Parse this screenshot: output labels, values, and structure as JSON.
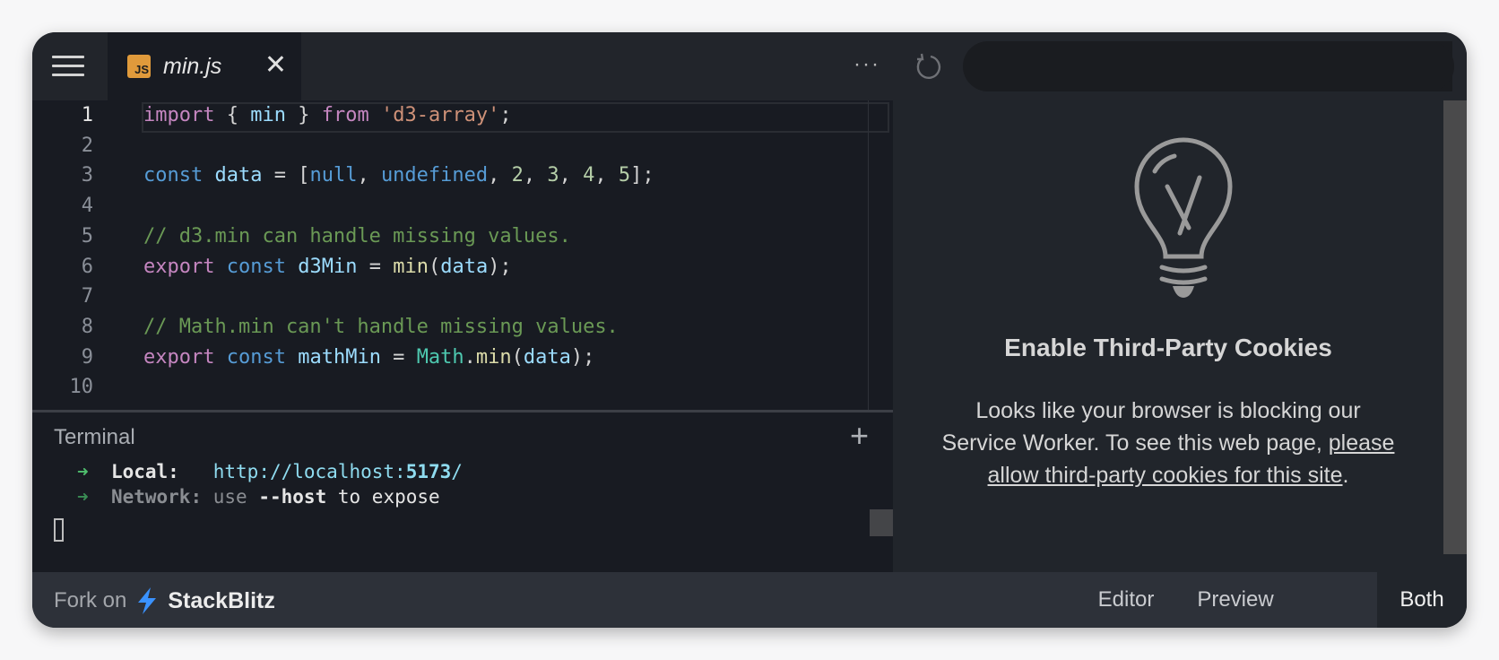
{
  "header": {
    "menu_icon": "hamburger-menu-icon",
    "tab": {
      "badge": "JS",
      "title": "min.js",
      "close_icon": "close-icon"
    },
    "more_label": "···",
    "refresh_icon": "refresh-icon",
    "url_value": ""
  },
  "editor": {
    "line_numbers": [
      "1",
      "2",
      "3",
      "4",
      "5",
      "6",
      "7",
      "8",
      "9",
      "10"
    ],
    "active_line": 1,
    "lines": [
      [
        {
          "t": "import",
          "c": "kw"
        },
        {
          "t": " { ",
          "c": ""
        },
        {
          "t": "min",
          "c": "var"
        },
        {
          "t": " } ",
          "c": ""
        },
        {
          "t": "from",
          "c": "kw"
        },
        {
          "t": " ",
          "c": ""
        },
        {
          "t": "'d3-array'",
          "c": "str"
        },
        {
          "t": ";",
          "c": ""
        }
      ],
      [],
      [
        {
          "t": "const",
          "c": "kw2"
        },
        {
          "t": " ",
          "c": ""
        },
        {
          "t": "data",
          "c": "var"
        },
        {
          "t": " = [",
          "c": ""
        },
        {
          "t": "null",
          "c": "kw2"
        },
        {
          "t": ", ",
          "c": ""
        },
        {
          "t": "undefined",
          "c": "kw2"
        },
        {
          "t": ", ",
          "c": ""
        },
        {
          "t": "2",
          "c": "num"
        },
        {
          "t": ", ",
          "c": ""
        },
        {
          "t": "3",
          "c": "num"
        },
        {
          "t": ", ",
          "c": ""
        },
        {
          "t": "4",
          "c": "num"
        },
        {
          "t": ", ",
          "c": ""
        },
        {
          "t": "5",
          "c": "num"
        },
        {
          "t": "];",
          "c": ""
        }
      ],
      [],
      [
        {
          "t": "// d3.min can handle missing values.",
          "c": "cm"
        }
      ],
      [
        {
          "t": "export",
          "c": "kw"
        },
        {
          "t": " ",
          "c": ""
        },
        {
          "t": "const",
          "c": "kw2"
        },
        {
          "t": " ",
          "c": ""
        },
        {
          "t": "d3Min",
          "c": "var"
        },
        {
          "t": " = ",
          "c": ""
        },
        {
          "t": "min",
          "c": "fn"
        },
        {
          "t": "(",
          "c": ""
        },
        {
          "t": "data",
          "c": "var"
        },
        {
          "t": ");",
          "c": ""
        }
      ],
      [],
      [
        {
          "t": "// Math.min can't handle missing values.",
          "c": "cm"
        }
      ],
      [
        {
          "t": "export",
          "c": "kw"
        },
        {
          "t": " ",
          "c": ""
        },
        {
          "t": "const",
          "c": "kw2"
        },
        {
          "t": " ",
          "c": ""
        },
        {
          "t": "mathMin",
          "c": "var"
        },
        {
          "t": " = ",
          "c": ""
        },
        {
          "t": "Math",
          "c": "cls"
        },
        {
          "t": ".",
          "c": ""
        },
        {
          "t": "min",
          "c": "fn"
        },
        {
          "t": "(",
          "c": ""
        },
        {
          "t": "data",
          "c": "var"
        },
        {
          "t": ");",
          "c": ""
        }
      ],
      []
    ]
  },
  "terminal": {
    "title": "Terminal",
    "add_icon": "plus-icon",
    "arrow": "➜",
    "local_label": "Local:",
    "local_url_prefix": "http://localhost:",
    "local_url_port": "5173",
    "local_url_suffix": "/",
    "network_label": "Network:",
    "network_use": "use",
    "network_flag": "--host",
    "network_rest": "to expose"
  },
  "preview": {
    "icon": "lightbulb-x-icon",
    "title": "Enable Third-Party Cookies",
    "body": "Looks like your browser is blocking our Service Worker. To see this web page,",
    "link": "please allow third-party cookies for this site",
    "after_link": "."
  },
  "footer": {
    "fork_label": "Fork on",
    "brand": "StackBlitz",
    "views": [
      {
        "label": "Editor",
        "active": false
      },
      {
        "label": "Preview",
        "active": false
      },
      {
        "label": "Both",
        "active": true
      }
    ]
  },
  "colors": {
    "accent_bolt": "#3a92ff",
    "js_badge": "#e09a3b"
  }
}
